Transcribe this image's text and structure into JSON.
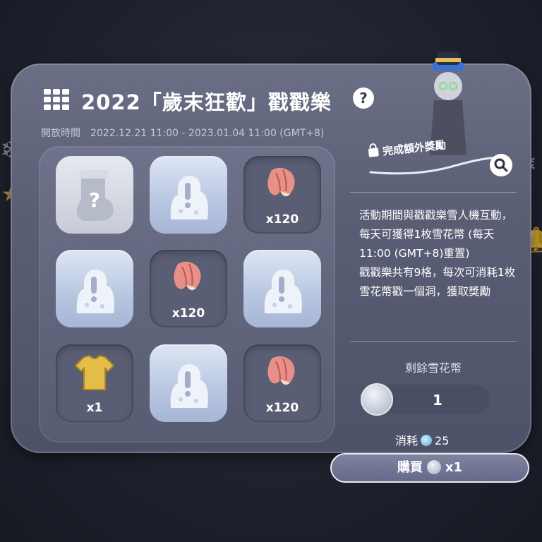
{
  "header": {
    "title": "2022「歲末狂歡」戳戳樂",
    "help_icon": "?",
    "period_label": "開放時間",
    "period_value": "2022.12.21 11:00 - 2023.01.04 11:00 (GMT+8)"
  },
  "board": {
    "cells": [
      {
        "state": "mystery",
        "icon": "stocking-question-icon",
        "qty": ""
      },
      {
        "state": "snowman",
        "icon": "snow-mound-icon",
        "qty": ""
      },
      {
        "state": "revealed",
        "icon": "seashell-icon",
        "qty": "x120"
      },
      {
        "state": "snowman",
        "icon": "snow-mound-icon",
        "qty": ""
      },
      {
        "state": "revealed",
        "icon": "seashell-icon",
        "qty": "x120"
      },
      {
        "state": "snowman",
        "icon": "snow-mound-icon",
        "qty": ""
      },
      {
        "state": "revealed",
        "icon": "tshirt-icon",
        "qty": "x1"
      },
      {
        "state": "snowman",
        "icon": "snow-mound-icon",
        "qty": ""
      },
      {
        "state": "revealed",
        "icon": "seashell-icon",
        "qty": "x120"
      }
    ]
  },
  "side": {
    "bonus_label": "完成額外獎勵",
    "description": [
      "活動期間與戳戳樂雪人機互動，每天可獲得1枚雪花幣 (每天11:00 (GMT+8)重置)",
      "戳戳樂共有9格，每次可消耗1枚雪花幣戳一個洞，獲取獎勵"
    ],
    "remaining_label": "剩餘雪花幣",
    "remaining_count": "1",
    "cost_label": "消耗",
    "cost_value": "25",
    "buy_label": "購買",
    "buy_qty": "x1"
  },
  "colors": {
    "panel": "#5a5e75",
    "snow_tile": "#b7c5e0",
    "hole_tile": "#5a5e74",
    "shell": "#d97f7a",
    "tshirt": "#d9b43c"
  }
}
